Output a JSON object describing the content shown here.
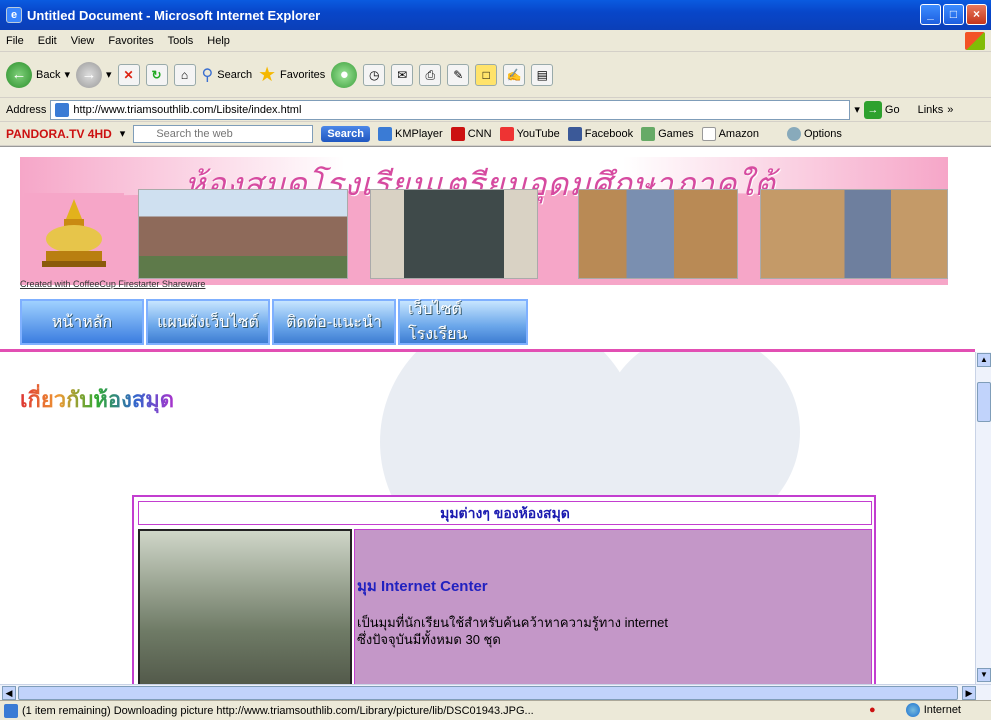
{
  "window": {
    "title": "Untitled Document - Microsoft Internet Explorer",
    "controls": [
      "_",
      "□",
      "×"
    ]
  },
  "menu": [
    "File",
    "Edit",
    "View",
    "Favorites",
    "Tools",
    "Help"
  ],
  "toolbar": {
    "back_label": "Back",
    "search_label": "Search",
    "favorites_label": "Favorites"
  },
  "address": {
    "label": "Address",
    "url": "http://www.triamsouthlib.com/Libsite/index.html",
    "go_label": "Go",
    "links_label": "Links"
  },
  "linksbar": {
    "brand": "PANDORA.TV 4HD",
    "search_placeholder": "Search the web",
    "search_button": "Search",
    "items": [
      "KMPlayer",
      "CNN",
      "YouTube",
      "Facebook",
      "Games",
      "Amazon",
      "Options"
    ]
  },
  "page": {
    "banner_title": "ห้องสมุดโรงเรียนเตรียมอุดมศึกษาภาคใต้",
    "created_with": "Created with CoffeeCup Firestarter Shareware",
    "nav": [
      "หน้าหลัก",
      "แผนผังเว็บไซต์",
      "ติดต่อ-แนะนำ",
      "เว็บไซต์โรงเรียน"
    ],
    "section_heading": "เกี่ยวกับห้องสมุด",
    "box": {
      "title": "มุมต่างๆ ของห้องสมุด",
      "corner_title": "มุม Internet Center",
      "desc_line1": "เป็นมุมที่นักเรียนใช้สำหรับค้นคว้าหาความรู้ทาง internet",
      "desc_line2": "ซึ่งปัจจุบันมีทั้งหมด 30 ชุด"
    }
  },
  "status": {
    "text": "(1 item remaining) Downloading picture http://www.triamsouthlib.com/Library/picture/lib/DSC01943.JPG...",
    "zone": "Internet"
  },
  "colors": {
    "banner_pink": "#f6a6c8",
    "accent_magenta": "#c33ed0",
    "nav_blue": "#3e7dd2",
    "box_purple": "#c497c8"
  }
}
